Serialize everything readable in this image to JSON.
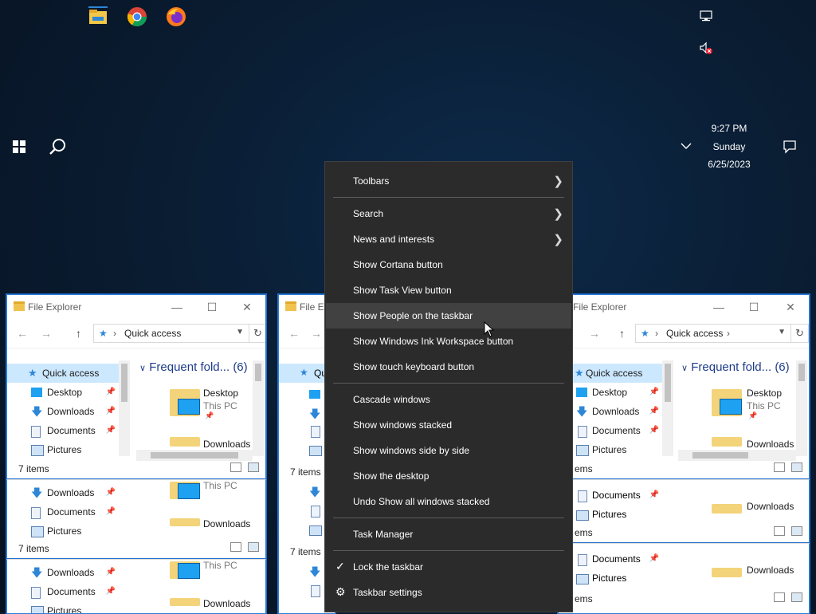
{
  "desktop": {
    "top_icons": [
      "file-explorer-icon",
      "chrome-icon",
      "firefox-icon"
    ],
    "tray_icons": [
      "network-icon",
      "volume-muted-icon"
    ]
  },
  "taskbar": {
    "time": "9:27 PM",
    "day": "Sunday",
    "date": "6/25/2023"
  },
  "explorer": {
    "title": "File Explorer",
    "partial_title": "File Ex",
    "address": "Quick access",
    "nav_items": [
      "Quick access",
      "Desktop",
      "Downloads",
      "Documents",
      "Pictures"
    ],
    "group_header": "Frequent fold...",
    "group_count": "(6)",
    "folders": [
      {
        "name": "Desktop",
        "sub": "This PC"
      },
      {
        "name": "Downloads",
        "sub": ""
      }
    ],
    "status": "7 items",
    "status_partial": "ems"
  },
  "context_menu": {
    "items": [
      {
        "label": "Toolbars",
        "submenu": true
      },
      {
        "label": "Search",
        "submenu": true
      },
      {
        "label": "News and interests",
        "submenu": true
      },
      {
        "label": "Show Cortana button"
      },
      {
        "label": "Show Task View button"
      },
      {
        "label": "Show People on the taskbar",
        "highlighted": true
      },
      {
        "label": "Show Windows Ink Workspace button"
      },
      {
        "label": "Show touch keyboard button"
      },
      {
        "label": "Cascade windows"
      },
      {
        "label": "Show windows stacked"
      },
      {
        "label": "Show windows side by side"
      },
      {
        "label": "Show the desktop"
      },
      {
        "label": "Undo Show all windows stacked"
      },
      {
        "label": "Task Manager"
      },
      {
        "label": "Lock the taskbar",
        "checked": true
      },
      {
        "label": "Taskbar settings",
        "icon": "gear-icon"
      }
    ]
  }
}
